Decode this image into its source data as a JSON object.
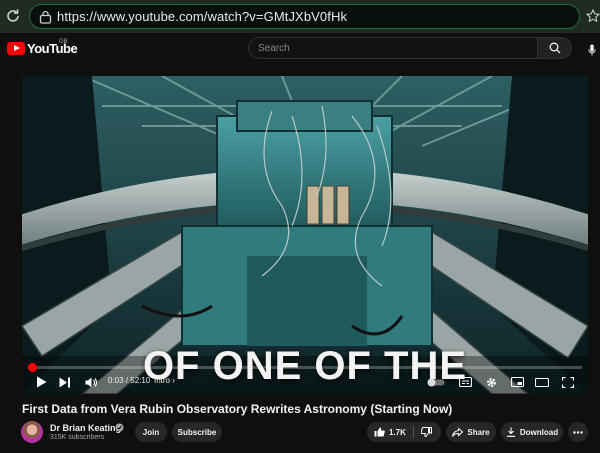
{
  "browser": {
    "url": "https://www.youtube.com/watch?v=GMtJXbV0fHk"
  },
  "header": {
    "logo_text": "YouTube",
    "country_code": "GB",
    "search_placeholder": "Search"
  },
  "player": {
    "caption": "OF ONE OF THE",
    "time_current": "0:03",
    "time_total": "52:10",
    "time_display": "0:03 / 52:10",
    "chapter": "Intro",
    "chapter_arrow": "›",
    "progress_fraction": 0.001
  },
  "video": {
    "title": "First Data from Vera Rubin Observatory Rewrites Astronomy (Starting Now)",
    "channel_name": "Dr Brian Keating",
    "subscribers": "315K subscribers",
    "join_label": "Join",
    "subscribe_label": "Subscribe",
    "like_count": "1.7K",
    "share_label": "Share",
    "download_label": "Download"
  },
  "colors": {
    "accent": "#ff0000",
    "url_border": "#1d6b3a"
  },
  "icons": [
    "reload-icon",
    "lock-icon",
    "star-icon",
    "search-icon",
    "mic-icon",
    "play-icon",
    "next-icon",
    "volume-icon",
    "autoplay-toggle",
    "subtitles-icon",
    "settings-icon",
    "miniplayer-icon",
    "theater-icon",
    "fullscreen-icon",
    "verified-icon",
    "like-icon",
    "dislike-icon",
    "share-icon",
    "download-icon",
    "more-icon"
  ]
}
